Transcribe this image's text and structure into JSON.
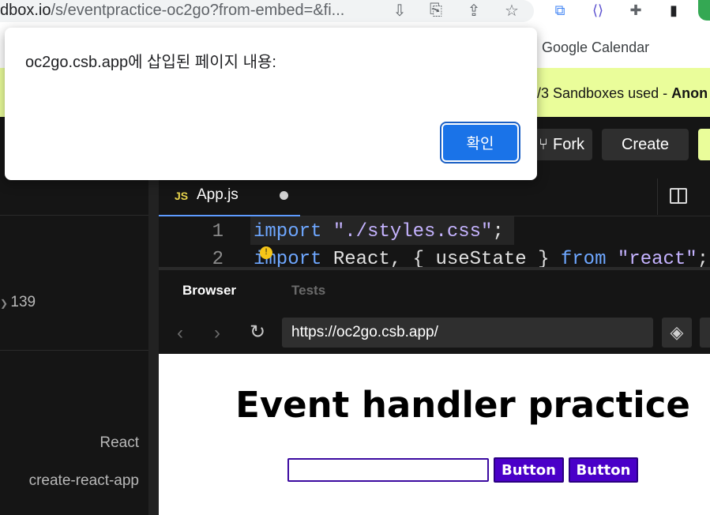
{
  "browser": {
    "url_prefix": "dbox.io",
    "url_path": "/s/eventpractice-oc2go?from-embed=&fi...",
    "bookmark": "Google Calendar"
  },
  "banner": {
    "text": "/3 Sandboxes used - ",
    "bold": "Anon"
  },
  "header": {
    "fork_label": "Fork",
    "create_label": "Create"
  },
  "sidebar": {
    "count": "139",
    "dependency_1": "React",
    "dependency_2": "create-react-app"
  },
  "editor": {
    "tab_badge": "JS",
    "tab_name": "App.js",
    "line_numbers": [
      "1",
      "2"
    ],
    "line1": {
      "kw": "import",
      "str": "\"./styles.css\"",
      "end": ";"
    },
    "line2": {
      "kw": "import",
      "mid": " React, { useState } ",
      "kw2": "from",
      "str": "\"react\"",
      "end": ";"
    }
  },
  "preview": {
    "tab_browser": "Browser",
    "tab_tests": "Tests",
    "address": "https://oc2go.csb.app/",
    "title": "Event handler practice",
    "input_value": "",
    "button1": "Button",
    "button2": "Button"
  },
  "dialog": {
    "message": "oc2go.csb.app에 삽입된 페이지 내용:",
    "ok_label": "확인"
  },
  "colors": {
    "banner": "#eafd9a",
    "accent_blue": "#1a73e8",
    "page_button": "#4a00c8"
  }
}
